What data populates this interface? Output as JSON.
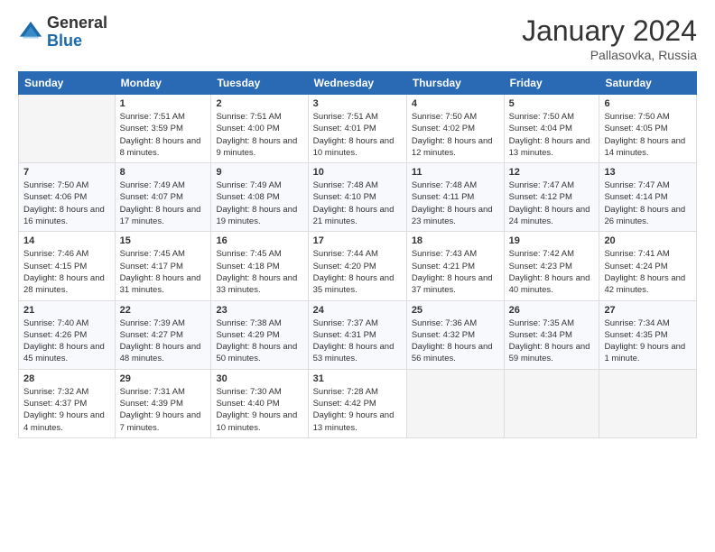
{
  "header": {
    "logo_general": "General",
    "logo_blue": "Blue",
    "month_year": "January 2024",
    "location": "Pallasovka, Russia"
  },
  "columns": [
    "Sunday",
    "Monday",
    "Tuesday",
    "Wednesday",
    "Thursday",
    "Friday",
    "Saturday"
  ],
  "weeks": [
    [
      {
        "day": "",
        "sunrise": "",
        "sunset": "",
        "daylight": ""
      },
      {
        "day": "1",
        "sunrise": "Sunrise: 7:51 AM",
        "sunset": "Sunset: 3:59 PM",
        "daylight": "Daylight: 8 hours and 8 minutes."
      },
      {
        "day": "2",
        "sunrise": "Sunrise: 7:51 AM",
        "sunset": "Sunset: 4:00 PM",
        "daylight": "Daylight: 8 hours and 9 minutes."
      },
      {
        "day": "3",
        "sunrise": "Sunrise: 7:51 AM",
        "sunset": "Sunset: 4:01 PM",
        "daylight": "Daylight: 8 hours and 10 minutes."
      },
      {
        "day": "4",
        "sunrise": "Sunrise: 7:50 AM",
        "sunset": "Sunset: 4:02 PM",
        "daylight": "Daylight: 8 hours and 12 minutes."
      },
      {
        "day": "5",
        "sunrise": "Sunrise: 7:50 AM",
        "sunset": "Sunset: 4:04 PM",
        "daylight": "Daylight: 8 hours and 13 minutes."
      },
      {
        "day": "6",
        "sunrise": "Sunrise: 7:50 AM",
        "sunset": "Sunset: 4:05 PM",
        "daylight": "Daylight: 8 hours and 14 minutes."
      }
    ],
    [
      {
        "day": "7",
        "sunrise": "Sunrise: 7:50 AM",
        "sunset": "Sunset: 4:06 PM",
        "daylight": "Daylight: 8 hours and 16 minutes."
      },
      {
        "day": "8",
        "sunrise": "Sunrise: 7:49 AM",
        "sunset": "Sunset: 4:07 PM",
        "daylight": "Daylight: 8 hours and 17 minutes."
      },
      {
        "day": "9",
        "sunrise": "Sunrise: 7:49 AM",
        "sunset": "Sunset: 4:08 PM",
        "daylight": "Daylight: 8 hours and 19 minutes."
      },
      {
        "day": "10",
        "sunrise": "Sunrise: 7:48 AM",
        "sunset": "Sunset: 4:10 PM",
        "daylight": "Daylight: 8 hours and 21 minutes."
      },
      {
        "day": "11",
        "sunrise": "Sunrise: 7:48 AM",
        "sunset": "Sunset: 4:11 PM",
        "daylight": "Daylight: 8 hours and 23 minutes."
      },
      {
        "day": "12",
        "sunrise": "Sunrise: 7:47 AM",
        "sunset": "Sunset: 4:12 PM",
        "daylight": "Daylight: 8 hours and 24 minutes."
      },
      {
        "day": "13",
        "sunrise": "Sunrise: 7:47 AM",
        "sunset": "Sunset: 4:14 PM",
        "daylight": "Daylight: 8 hours and 26 minutes."
      }
    ],
    [
      {
        "day": "14",
        "sunrise": "Sunrise: 7:46 AM",
        "sunset": "Sunset: 4:15 PM",
        "daylight": "Daylight: 8 hours and 28 minutes."
      },
      {
        "day": "15",
        "sunrise": "Sunrise: 7:45 AM",
        "sunset": "Sunset: 4:17 PM",
        "daylight": "Daylight: 8 hours and 31 minutes."
      },
      {
        "day": "16",
        "sunrise": "Sunrise: 7:45 AM",
        "sunset": "Sunset: 4:18 PM",
        "daylight": "Daylight: 8 hours and 33 minutes."
      },
      {
        "day": "17",
        "sunrise": "Sunrise: 7:44 AM",
        "sunset": "Sunset: 4:20 PM",
        "daylight": "Daylight: 8 hours and 35 minutes."
      },
      {
        "day": "18",
        "sunrise": "Sunrise: 7:43 AM",
        "sunset": "Sunset: 4:21 PM",
        "daylight": "Daylight: 8 hours and 37 minutes."
      },
      {
        "day": "19",
        "sunrise": "Sunrise: 7:42 AM",
        "sunset": "Sunset: 4:23 PM",
        "daylight": "Daylight: 8 hours and 40 minutes."
      },
      {
        "day": "20",
        "sunrise": "Sunrise: 7:41 AM",
        "sunset": "Sunset: 4:24 PM",
        "daylight": "Daylight: 8 hours and 42 minutes."
      }
    ],
    [
      {
        "day": "21",
        "sunrise": "Sunrise: 7:40 AM",
        "sunset": "Sunset: 4:26 PM",
        "daylight": "Daylight: 8 hours and 45 minutes."
      },
      {
        "day": "22",
        "sunrise": "Sunrise: 7:39 AM",
        "sunset": "Sunset: 4:27 PM",
        "daylight": "Daylight: 8 hours and 48 minutes."
      },
      {
        "day": "23",
        "sunrise": "Sunrise: 7:38 AM",
        "sunset": "Sunset: 4:29 PM",
        "daylight": "Daylight: 8 hours and 50 minutes."
      },
      {
        "day": "24",
        "sunrise": "Sunrise: 7:37 AM",
        "sunset": "Sunset: 4:31 PM",
        "daylight": "Daylight: 8 hours and 53 minutes."
      },
      {
        "day": "25",
        "sunrise": "Sunrise: 7:36 AM",
        "sunset": "Sunset: 4:32 PM",
        "daylight": "Daylight: 8 hours and 56 minutes."
      },
      {
        "day": "26",
        "sunrise": "Sunrise: 7:35 AM",
        "sunset": "Sunset: 4:34 PM",
        "daylight": "Daylight: 8 hours and 59 minutes."
      },
      {
        "day": "27",
        "sunrise": "Sunrise: 7:34 AM",
        "sunset": "Sunset: 4:35 PM",
        "daylight": "Daylight: 9 hours and 1 minute."
      }
    ],
    [
      {
        "day": "28",
        "sunrise": "Sunrise: 7:32 AM",
        "sunset": "Sunset: 4:37 PM",
        "daylight": "Daylight: 9 hours and 4 minutes."
      },
      {
        "day": "29",
        "sunrise": "Sunrise: 7:31 AM",
        "sunset": "Sunset: 4:39 PM",
        "daylight": "Daylight: 9 hours and 7 minutes."
      },
      {
        "day": "30",
        "sunrise": "Sunrise: 7:30 AM",
        "sunset": "Sunset: 4:40 PM",
        "daylight": "Daylight: 9 hours and 10 minutes."
      },
      {
        "day": "31",
        "sunrise": "Sunrise: 7:28 AM",
        "sunset": "Sunset: 4:42 PM",
        "daylight": "Daylight: 9 hours and 13 minutes."
      },
      {
        "day": "",
        "sunrise": "",
        "sunset": "",
        "daylight": ""
      },
      {
        "day": "",
        "sunrise": "",
        "sunset": "",
        "daylight": ""
      },
      {
        "day": "",
        "sunrise": "",
        "sunset": "",
        "daylight": ""
      }
    ]
  ]
}
